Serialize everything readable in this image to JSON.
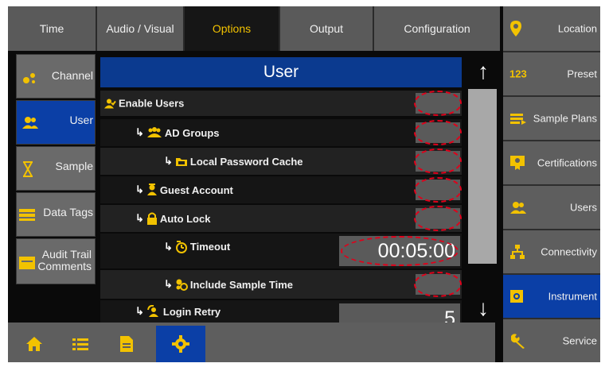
{
  "tabs": [
    {
      "label": "Time",
      "active": false
    },
    {
      "label": "Audio / Visual",
      "active": false
    },
    {
      "label": "Options",
      "active": true
    },
    {
      "label": "Output",
      "active": false
    },
    {
      "label": "Configuration",
      "active": false
    }
  ],
  "side_nav": [
    {
      "label": "Channel",
      "icon": "channel-icon",
      "active": false
    },
    {
      "label": "User",
      "icon": "users-icon",
      "active": true
    },
    {
      "label": "Sample",
      "icon": "hourglass-icon",
      "active": false
    },
    {
      "label": "Data Tags",
      "icon": "data-tags-icon",
      "active": false
    },
    {
      "label": "Audit Trail Comments",
      "icon": "comment-icon",
      "active": false
    }
  ],
  "panel": {
    "title": "User",
    "rows": [
      {
        "label": "Enable Users",
        "icon": "user-check-icon",
        "control": "checkbox"
      },
      {
        "label": "AD Groups",
        "icon": "group-icon",
        "control": "checkbox"
      },
      {
        "label": "Local Password Cache",
        "icon": "folder-icon",
        "control": "checkbox"
      },
      {
        "label": "Guest Account",
        "icon": "guest-icon",
        "control": "checkbox"
      },
      {
        "label": "Auto Lock",
        "icon": "lock-icon",
        "control": "checkbox"
      },
      {
        "label": "Timeout",
        "icon": "timer-icon",
        "control": "value",
        "value": "00:05:00"
      },
      {
        "label": "Include Sample Time",
        "icon": "sample-time-icon",
        "control": "checkbox"
      },
      {
        "label": "Login Retry",
        "icon": "retry-icon",
        "control": "value",
        "value": "5"
      }
    ]
  },
  "scroll": {
    "up": "↑",
    "down": "↓"
  },
  "right_nav": [
    {
      "label": "Location",
      "icon": "location-pin-icon",
      "active": false
    },
    {
      "label": "Preset",
      "icon": "preset-123-icon",
      "icon_text": "123",
      "active": false
    },
    {
      "label": "Sample Plans",
      "icon": "sample-plans-icon",
      "active": false
    },
    {
      "label": "Certifications",
      "icon": "certificate-icon",
      "active": false
    },
    {
      "label": "Users",
      "icon": "users-icon",
      "active": false
    },
    {
      "label": "Connectivity",
      "icon": "network-icon",
      "active": false
    },
    {
      "label": "Instrument",
      "icon": "instrument-icon",
      "active": true
    },
    {
      "label": "Service",
      "icon": "wrench-icon",
      "active": false
    }
  ],
  "bottom_bar": [
    {
      "icon": "home-icon",
      "active": false
    },
    {
      "icon": "list-icon",
      "active": false
    },
    {
      "icon": "document-icon",
      "active": false
    },
    {
      "icon": "gear-icon",
      "active": true
    }
  ],
  "colors": {
    "accent_yellow": "#f2c200",
    "active_blue": "#0b3fa6",
    "title_blue": "#0b3a8f",
    "highlight_red": "#e0001a"
  }
}
